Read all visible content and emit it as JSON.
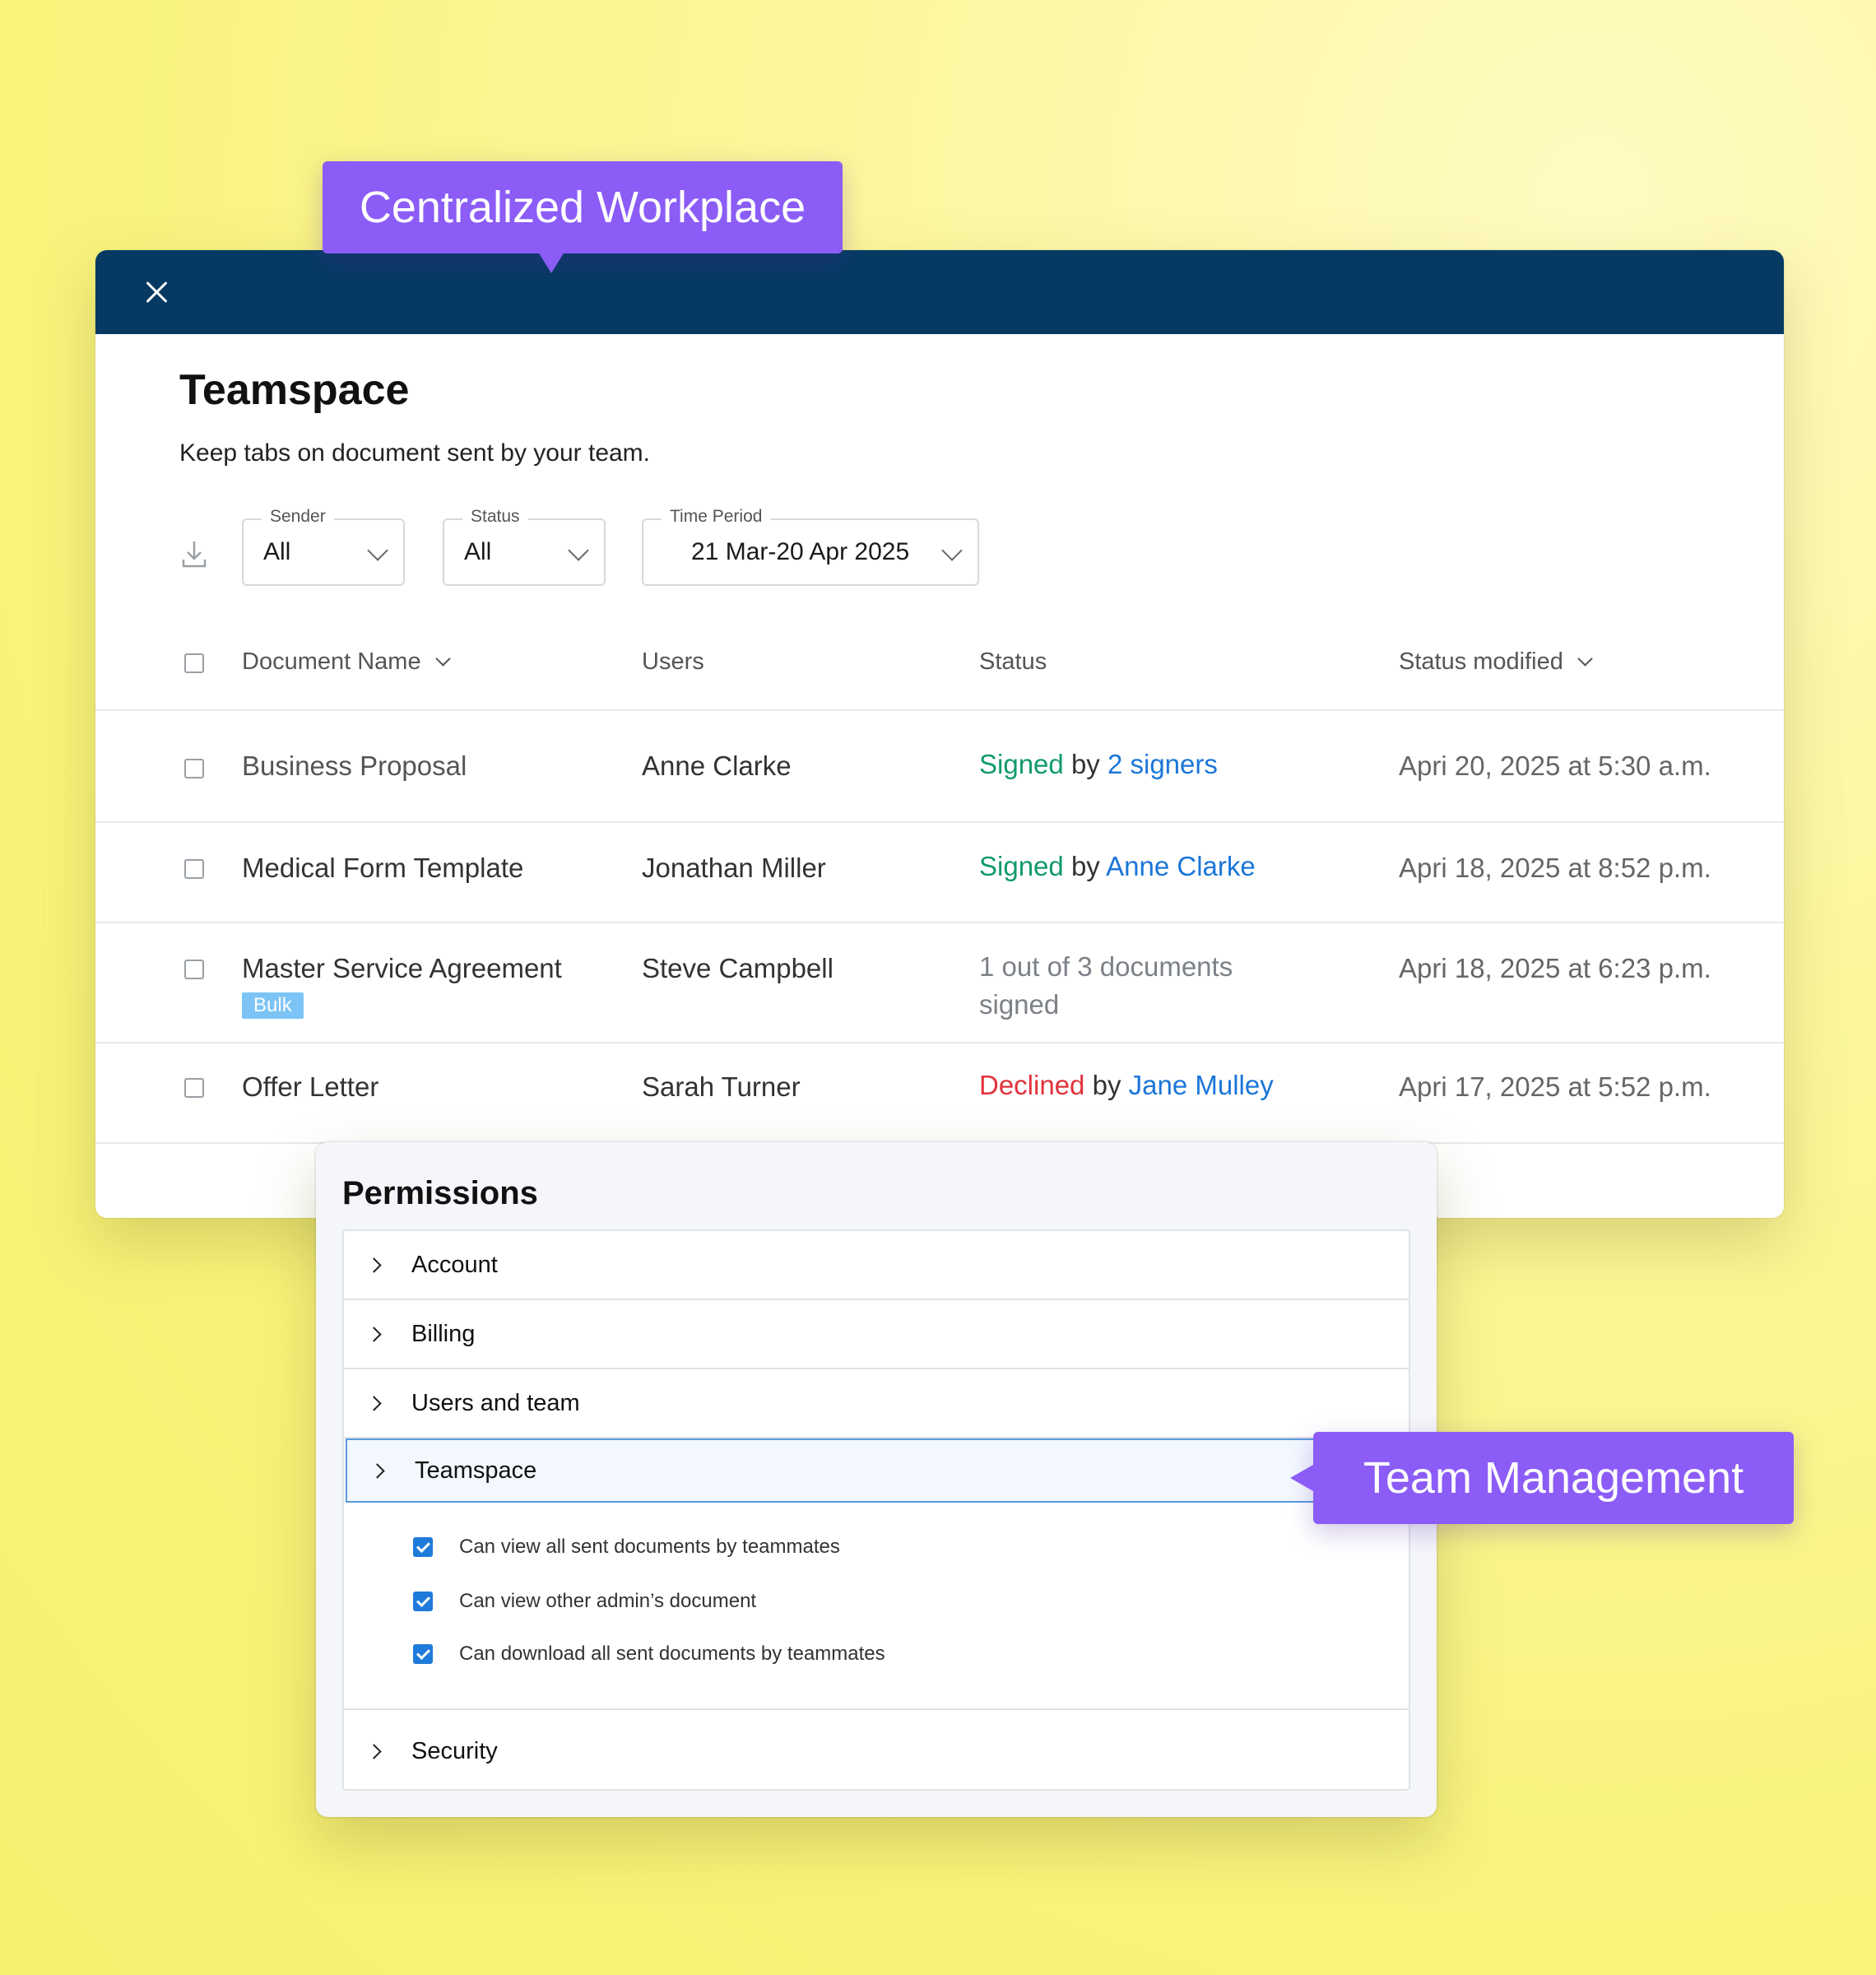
{
  "callouts": {
    "top": "Centralized Workplace",
    "bottom": "Team Management"
  },
  "window": {
    "title": "Teamspace",
    "subtitle": "Keep tabs on document sent by your team."
  },
  "filters": {
    "sender": {
      "label": "Sender",
      "value": "All"
    },
    "status": {
      "label": "Status",
      "value": "All"
    },
    "period": {
      "label": "Time Period",
      "value": "21 Mar-20 Apr 2025"
    }
  },
  "table": {
    "headers": {
      "name": "Document Name",
      "users": "Users",
      "status": "Status",
      "modified": "Status modified"
    },
    "rows": [
      {
        "name": "Business Proposal",
        "user": "Anne Clarke",
        "status_word": "Signed",
        "by": "by",
        "status_who": "2 signers",
        "date": "Apri 20, 2025 at 5:30 a.m."
      },
      {
        "name": "Medical Form Template",
        "user": "Jonathan Miller",
        "status_word": "Signed",
        "by": "by",
        "status_who": "Anne Clarke",
        "date": "Apri 18, 2025 at 8:52 p.m."
      },
      {
        "name": "Master Service Agreement",
        "badge": "Bulk",
        "user": "Steve Campbell",
        "status_text": "1 out of 3 documents signed",
        "date": "Apri 18, 2025 at 6:23 p.m."
      },
      {
        "name": "Offer Letter",
        "user": "Sarah Turner",
        "status_word": "Declined",
        "by": "by",
        "status_who": "Jane Mulley",
        "date": "Apri 17, 2025 at 5:52 p.m."
      }
    ]
  },
  "permissions": {
    "title": "Permissions",
    "items": [
      "Account",
      "Billing",
      "Users and team",
      "Teamspace",
      "Security"
    ],
    "options": [
      "Can view all sent documents by teammates",
      "Can view other admin’s document",
      "Can download all sent documents by teammates"
    ]
  },
  "colors": {
    "accent": "#8b5cf6",
    "titlebar": "#063a63",
    "signed": "#129a6b",
    "declined": "#e2323a",
    "link": "#1b76d8"
  }
}
